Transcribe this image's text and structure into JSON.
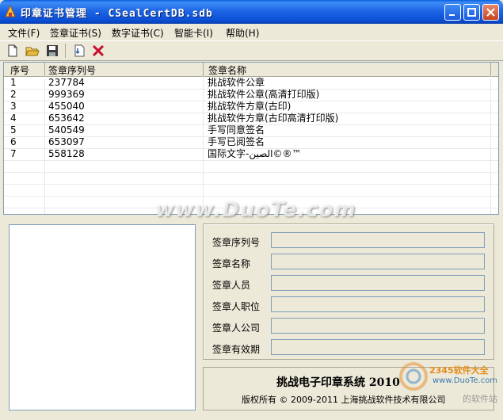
{
  "window": {
    "title": "印章证书管理 - CSealCertDB.sdb"
  },
  "menu": [
    {
      "label": "文件(F)"
    },
    {
      "label": "签章证书(S)"
    },
    {
      "label": "数字证书(C)"
    },
    {
      "label": "智能卡(I)"
    },
    {
      "label": "帮助(H)"
    }
  ],
  "toolbar": {
    "icons": [
      "new-file-icon",
      "open-folder-icon",
      "save-disk-icon",
      "import-cert-icon",
      "delete-x-icon"
    ]
  },
  "table": {
    "headers": [
      "序号",
      "签章序列号",
      "签章名称"
    ],
    "rows": [
      [
        "1",
        "237784",
        "挑战软件公章"
      ],
      [
        "2",
        "999369",
        "挑战软件公章(高清打印版)"
      ],
      [
        "3",
        "455040",
        "挑战软件方章(古印)"
      ],
      [
        "4",
        "653642",
        "挑战软件方章(古印高清打印版)"
      ],
      [
        "5",
        "540549",
        "手写同意签名"
      ],
      [
        "6",
        "653097",
        "手写已阅签名"
      ],
      [
        "7",
        "558128",
        "国际文字-الصين©®™"
      ]
    ]
  },
  "details": {
    "labels": [
      "签章序列号",
      "签章名称",
      "签章人员",
      "签章人职位",
      "签章人公司",
      "签章有效期"
    ]
  },
  "brand": {
    "title": "挑战电子印章系统  2010",
    "copyright": "版权所有 © 2009-2011 上海挑战软件技术有限公司"
  },
  "watermarks": {
    "duote": "www.DuoTe.com",
    "site_a": "2345软件大全",
    "site_b": "www.DuoTe.com",
    "site_c": "的软件站"
  },
  "colors": {
    "titlebar": "#0b4fd6",
    "window_bg": "#ece9d8",
    "delete_red": "#c8102e"
  }
}
